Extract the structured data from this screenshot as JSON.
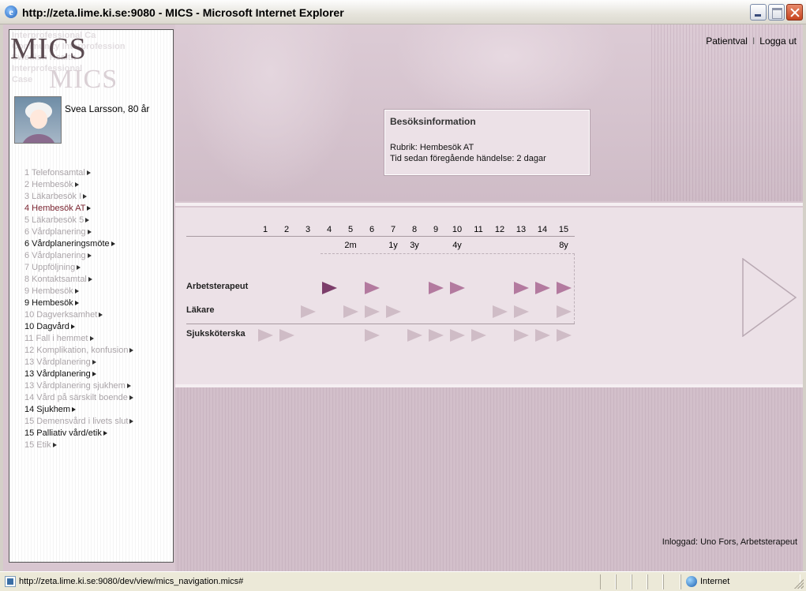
{
  "window": {
    "title": "http://zeta.lime.ki.se:9080 - MICS - Microsoft Internet Explorer"
  },
  "sidebar": {
    "logo_primary": "MICS",
    "logo_secondary": "MICS",
    "logo_ghost_lines": [
      "Interprofessional Ca",
      "Community Interprofession",
      "Swedish Health",
      "Interprofessional",
      "Case"
    ],
    "patient_name": "Svea Larsson, 80 år",
    "nav_items": [
      {
        "label": "1 Telefonsamtal",
        "state": "dim"
      },
      {
        "label": "2 Hembesök",
        "state": "dim"
      },
      {
        "label": "3 Läkarbesök I",
        "state": "dim"
      },
      {
        "label": "4 Hembesök AT",
        "state": "current"
      },
      {
        "label": "5 Läkarbesök 5",
        "state": "dim"
      },
      {
        "label": "6 Vårdplanering",
        "state": "dim"
      },
      {
        "label": "6 Vårdplaneringsmöte",
        "state": "dark"
      },
      {
        "label": "6 Vårdplanering",
        "state": "dim"
      },
      {
        "label": "7 Uppföljning",
        "state": "dim"
      },
      {
        "label": "8 Kontaktsamtal",
        "state": "dim"
      },
      {
        "label": "9 Hembesök",
        "state": "dim"
      },
      {
        "label": "9 Hembesök",
        "state": "dark"
      },
      {
        "label": "10 Dagverksamhet",
        "state": "dim"
      },
      {
        "label": "10 Dagvård",
        "state": "dark"
      },
      {
        "label": "11 Fall i hemmet",
        "state": "dim"
      },
      {
        "label": "12 Komplikation, konfusion",
        "state": "dim"
      },
      {
        "label": "13 Vårdplanering",
        "state": "dim"
      },
      {
        "label": "13 Vårdplanering",
        "state": "dark"
      },
      {
        "label": "13 Vårdplanering sjukhem",
        "state": "dim"
      },
      {
        "label": "14 Vård på särskilt boende",
        "state": "dim"
      },
      {
        "label": "14 Sjukhem",
        "state": "dark"
      },
      {
        "label": "15 Demensvård i livets slut",
        "state": "dim"
      },
      {
        "label": "15 Palliativ vård/etik",
        "state": "dark"
      },
      {
        "label": "15 Etik",
        "state": "dim"
      }
    ]
  },
  "header": {
    "links": [
      "Patientval",
      "Logga ut"
    ],
    "separator": "I"
  },
  "info_box": {
    "title": "Besöksinformation",
    "rubrik": "Rubrik: Hembesök AT",
    "time_since": "Tid sedan föregående händelse: 2 dagar"
  },
  "timeline": {
    "columns": [
      "1",
      "2",
      "3",
      "4",
      "5",
      "6",
      "7",
      "8",
      "9",
      "10",
      "11",
      "12",
      "13",
      "14",
      "15"
    ],
    "intervals": {
      "5": "2m",
      "7": "1y",
      "8": "3y",
      "10": "4y",
      "15": "8y"
    },
    "rows": [
      {
        "label": "Arbetsterapeut",
        "markers": {
          "4": "current",
          "6": "highlight",
          "9": "highlight",
          "10": "highlight",
          "13": "highlight",
          "14": "highlight",
          "15": "highlight"
        }
      },
      {
        "label": "Läkare",
        "markers": {
          "3": "light",
          "5": "light",
          "6": "light",
          "7": "light",
          "12": "light",
          "13": "light",
          "15": "light"
        }
      },
      {
        "label": "Sjuksköterska",
        "markers": {
          "1": "light",
          "2": "light",
          "6": "light",
          "8": "light",
          "9": "light",
          "10": "light",
          "11": "light",
          "13": "light",
          "14": "light",
          "15": "light"
        }
      }
    ]
  },
  "footer": {
    "logged_in": "Inloggad: Uno Fors, Arbetsterapeut"
  },
  "statusbar": {
    "url": "http://zeta.lime.ki.se:9080/dev/view/mics_navigation.mics#",
    "zone": "Internet"
  }
}
